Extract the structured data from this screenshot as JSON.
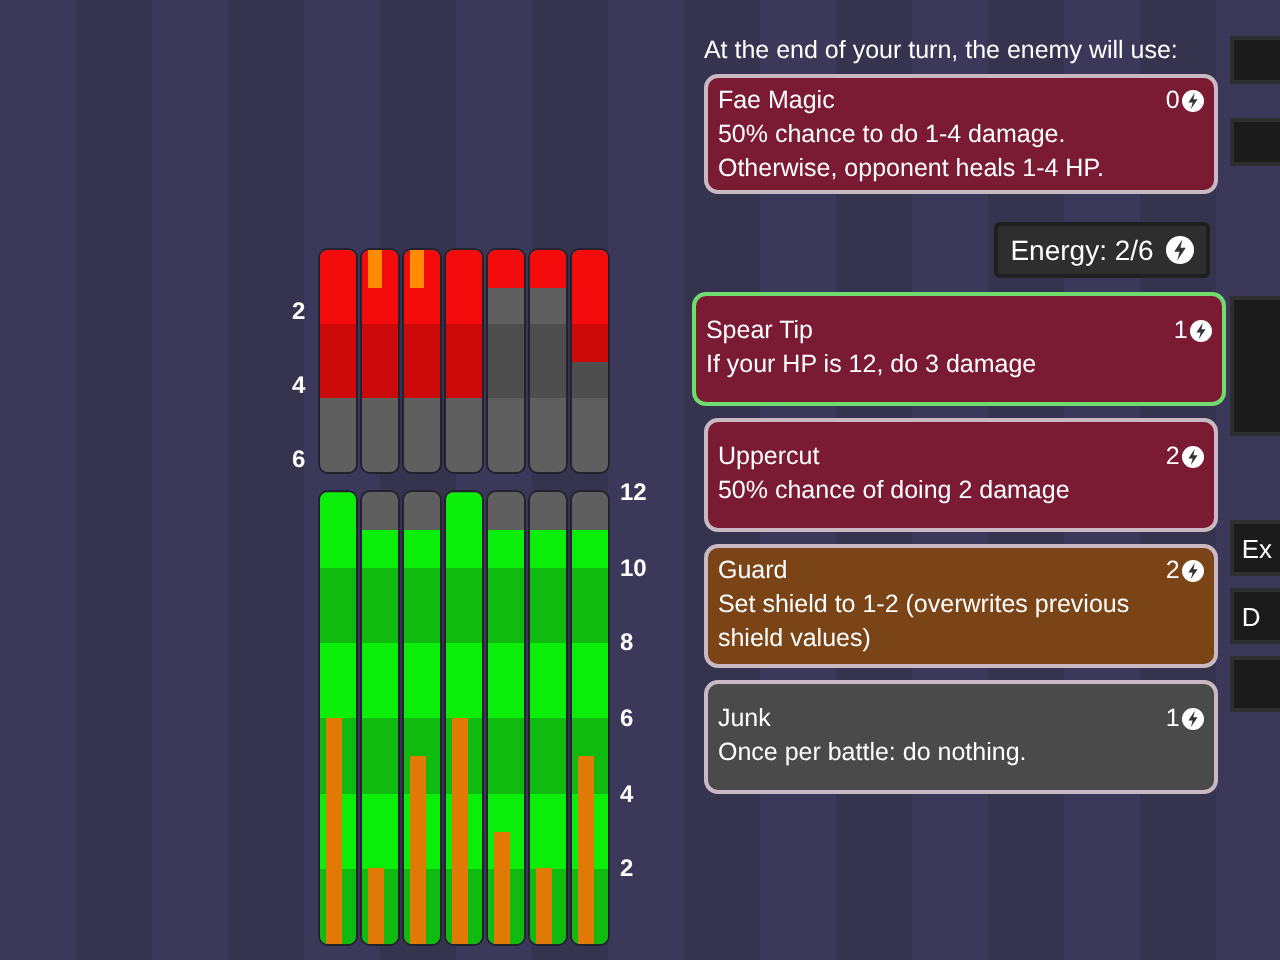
{
  "enemy_scale": [
    "2",
    "4",
    "6"
  ],
  "enemy_bars": [
    {
      "level": 0.667
    },
    {
      "level": 0.667,
      "marker": {
        "level": 0.167
      }
    },
    {
      "level": 0.667,
      "marker": {
        "level": 0.167
      }
    },
    {
      "level": 0.667
    },
    {
      "level": 0.167
    },
    {
      "level": 0.167
    },
    {
      "level": 0.5
    }
  ],
  "player_scale": [
    "12",
    "10",
    "8",
    "6",
    "4",
    "2"
  ],
  "player_bars": [
    {
      "level": 1,
      "overlay": {
        "level": 0.5
      }
    },
    {
      "level": 0.917,
      "overlay": {
        "level": 0.167
      }
    },
    {
      "level": 0.917,
      "overlay": {
        "level": 0.417
      }
    },
    {
      "level": 1,
      "overlay": {
        "level": 0.5
      }
    },
    {
      "level": 0.917,
      "overlay": {
        "level": 0.25
      }
    },
    {
      "level": 0.917,
      "overlay": {
        "level": 0.167
      }
    },
    {
      "level": 0.917,
      "overlay": {
        "level": 0.417
      }
    }
  ],
  "intent_label": "At the end of your turn, the enemy will use:",
  "enemy_move": {
    "title": "Fae Magic",
    "cost": "0",
    "description": "50% chance to do 1-4 damage. Otherwise, opponent heals 1-4 HP.",
    "color": "#7b1a33"
  },
  "energy": {
    "label": "Energy: 2/6"
  },
  "cards": [
    {
      "title": "Spear Tip",
      "cost": "1",
      "description": "If your HP is 12, do 3 damage",
      "color": "#7b1a33",
      "selected": true
    },
    {
      "title": "Uppercut",
      "cost": "2",
      "description": "50% chance of doing 2 damage",
      "color": "#7b1a33",
      "selected": false
    },
    {
      "title": "Guard",
      "cost": "2",
      "description": "Set shield to 1-2 (overwrites previous shield values)",
      "color": "#7a4417",
      "selected": false
    },
    {
      "title": "Junk",
      "cost": "1",
      "description": "Once per battle: do nothing.",
      "color": "#4a4a4a",
      "selected": false
    }
  ],
  "side_buttons": [
    {
      "label": "Ex"
    },
    {
      "label": "D"
    }
  ]
}
